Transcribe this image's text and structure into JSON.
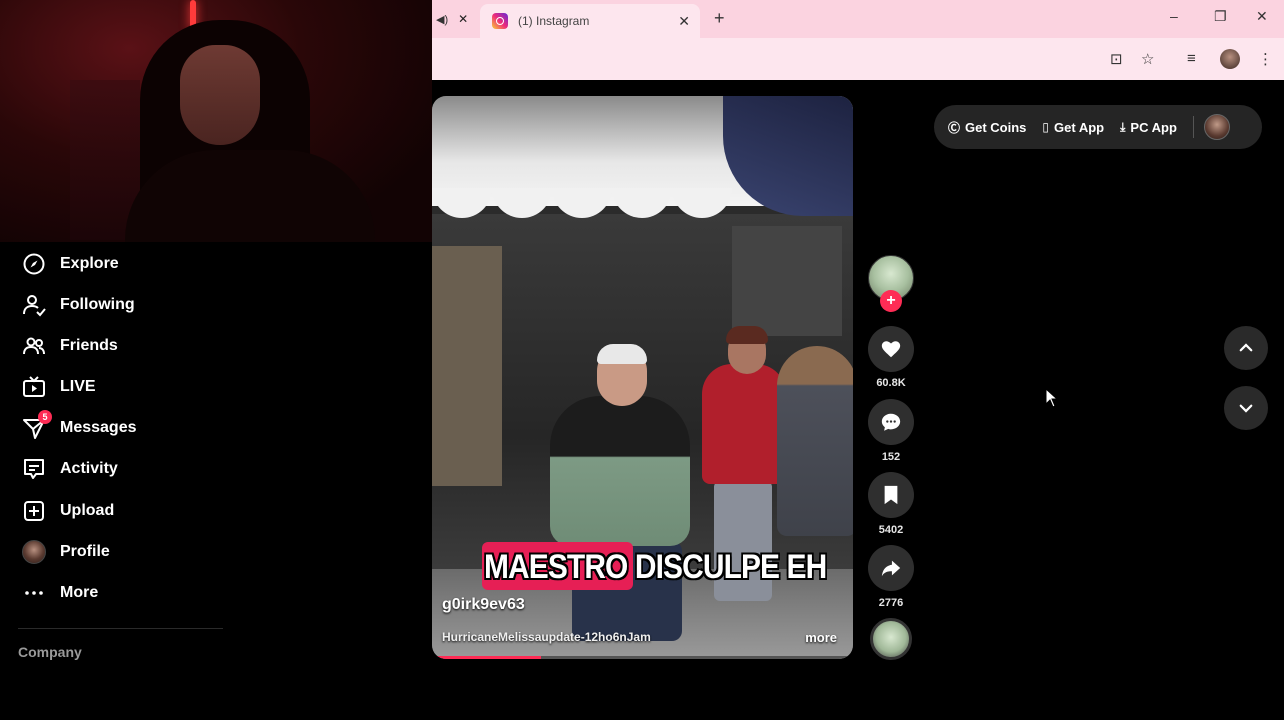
{
  "browser": {
    "active_tab_title": "(1) Instagram",
    "new_tab_glyph": "+",
    "tab_close_glyph": "✕",
    "window_controls": [
      "–",
      "❐",
      "✕"
    ]
  },
  "sidebar": {
    "items": [
      {
        "label": "Explore",
        "icon": "compass-icon"
      },
      {
        "label": "Following",
        "icon": "user-follow-icon"
      },
      {
        "label": "Friends",
        "icon": "friends-icon"
      },
      {
        "label": "LIVE",
        "icon": "live-tv-icon"
      },
      {
        "label": "Messages",
        "icon": "paper-plane-icon",
        "badge": "5"
      },
      {
        "label": "Activity",
        "icon": "activity-icon"
      },
      {
        "label": "Upload",
        "icon": "upload-plus-icon"
      },
      {
        "label": "Profile",
        "icon": "profile-avatar"
      },
      {
        "label": "More",
        "icon": "more-dots-icon"
      }
    ],
    "footer_heading": "Company"
  },
  "video": {
    "caption": "MAESTRO DISCULPE EH",
    "author": "g0irk9ev63",
    "description": "HurricaneMelissaupdate-12ho6nJam",
    "more_label": "more",
    "progress": 0.26
  },
  "actions": {
    "likes": "60.8K",
    "comments": "152",
    "saves": "5402",
    "shares": "2776",
    "follow_glyph": "+"
  },
  "top_pill": {
    "get_coins": "Get Coins",
    "get_app": "Get App",
    "pc_app": "PC App"
  },
  "colors": {
    "accent": "#fe2c55",
    "caption_bg": "#e61f55",
    "browser_tab_bar": "#fbd3e0"
  }
}
